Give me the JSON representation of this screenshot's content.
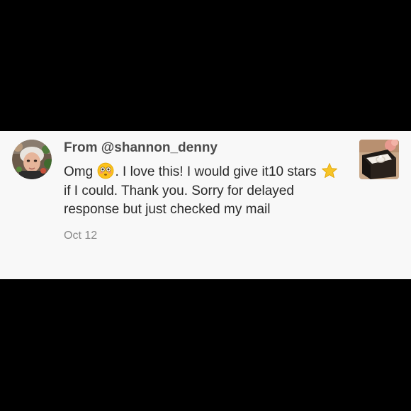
{
  "comment": {
    "from_label": "From @shannon_denny",
    "message": {
      "part1": "Omg",
      "emoji1": "flushed-face-emoji",
      "part2": ". I love this! I would give it10 stars",
      "emoji2": "star-emoji",
      "part3": "if I could. Thank you. Sorry for delayed response but just checked my mail"
    },
    "date": "Oct 12"
  },
  "colors": {
    "background": "#000000",
    "card": "#f8f8f8",
    "username_text": "#4a4a4a",
    "message_text": "#2a2a2a",
    "date_text": "#8a8a8a",
    "star": "#f7c427"
  }
}
